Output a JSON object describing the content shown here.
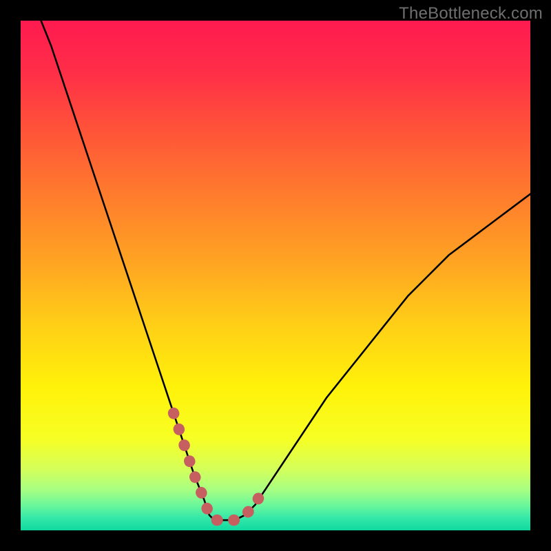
{
  "watermark": "TheBottleneck.com",
  "chart_data": {
    "type": "line",
    "title": "",
    "xlabel": "",
    "ylabel": "",
    "xlim": [
      0,
      100
    ],
    "ylim": [
      0,
      100
    ],
    "grid": false,
    "legend": false,
    "series": [
      {
        "name": "bottleneck-curve",
        "x": [
          4,
          6,
          8,
          10,
          12,
          14,
          16,
          18,
          20,
          22,
          24,
          26,
          28,
          30,
          32,
          34,
          36,
          37,
          38,
          40,
          42,
          44,
          46,
          48,
          52,
          56,
          60,
          64,
          68,
          72,
          76,
          80,
          84,
          88,
          92,
          96,
          100
        ],
        "y": [
          100,
          95,
          89,
          83,
          77,
          71,
          65,
          59,
          53,
          47,
          41,
          35,
          29,
          23,
          17,
          11,
          6,
          3,
          2,
          2,
          2,
          3,
          5,
          8,
          14,
          20,
          26,
          31,
          36,
          41,
          46,
          50,
          54,
          57,
          60,
          63,
          66
        ]
      }
    ],
    "highlight_segment": {
      "name": "min-region-dots",
      "color": "#c66060",
      "x_range": [
        30,
        46
      ],
      "points": [
        {
          "x": 30,
          "y": 23
        },
        {
          "x": 32,
          "y": 17
        },
        {
          "x": 34,
          "y": 11
        },
        {
          "x": 36,
          "y": 6
        },
        {
          "x": 37,
          "y": 3
        },
        {
          "x": 38,
          "y": 2
        },
        {
          "x": 40,
          "y": 2
        },
        {
          "x": 42,
          "y": 2
        },
        {
          "x": 44,
          "y": 3
        },
        {
          "x": 45,
          "y": 4
        },
        {
          "x": 46,
          "y": 5
        },
        {
          "x": 47,
          "y": 7
        },
        {
          "x": 48,
          "y": 8
        }
      ]
    },
    "background_gradient_stops": [
      {
        "offset": 0.0,
        "color": "#ff1a50"
      },
      {
        "offset": 0.1,
        "color": "#ff2e48"
      },
      {
        "offset": 0.22,
        "color": "#ff5538"
      },
      {
        "offset": 0.35,
        "color": "#ff7e2c"
      },
      {
        "offset": 0.48,
        "color": "#ffa622"
      },
      {
        "offset": 0.6,
        "color": "#ffd016"
      },
      {
        "offset": 0.72,
        "color": "#fff20a"
      },
      {
        "offset": 0.82,
        "color": "#f7ff24"
      },
      {
        "offset": 0.88,
        "color": "#d4ff5a"
      },
      {
        "offset": 0.92,
        "color": "#a8ff82"
      },
      {
        "offset": 0.95,
        "color": "#6cf79a"
      },
      {
        "offset": 0.975,
        "color": "#36e8a8"
      },
      {
        "offset": 1.0,
        "color": "#0fd9a0"
      }
    ]
  }
}
